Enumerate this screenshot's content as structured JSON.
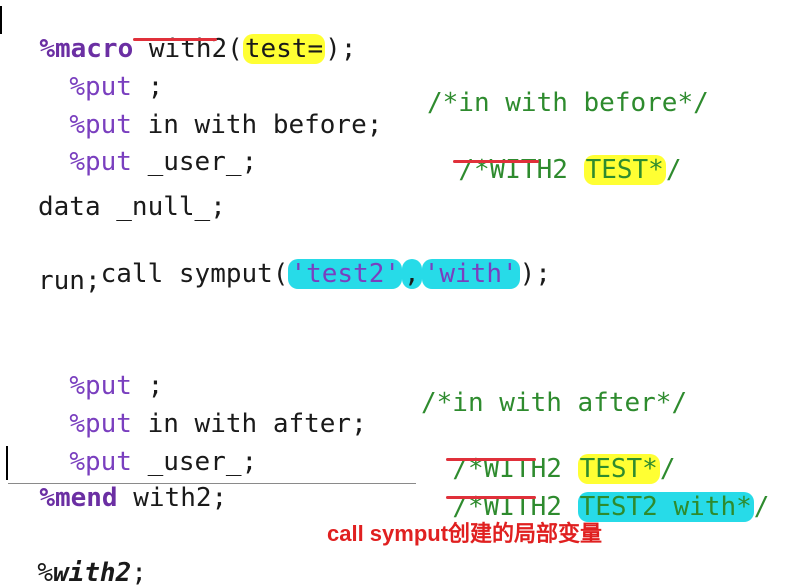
{
  "code": {
    "macro_kw": "%macro",
    "macro_name": "with2",
    "macro_params_open": "(",
    "macro_param": "test=",
    "macro_params_close": ");",
    "l2_put": "%put",
    "l2_rest": " ;",
    "l3_put": "%put",
    "l3_rest": " in with before;",
    "l4_put": "%put",
    "l4_rest": " _user_;",
    "l6": "data _null_;",
    "l7_pre": "  call symput(",
    "l7_arg1": "'test2'",
    "l7_comma": ",",
    "l7_arg2": "'with'",
    "l7_post": ");",
    "l8": "run;",
    "l10_put": "%put",
    "l10_rest": " ;",
    "l11_put": "%put",
    "l11_rest": " in with after;",
    "l12_put": "%put",
    "l12_rest": " _user_;",
    "mend_kw": "%mend",
    "mend_rest": " with2;",
    "invoke_pct": "%",
    "invoke_name": "with2",
    "invoke_semi": ";"
  },
  "comments": {
    "before": "/*in with before*/",
    "before_user_pre": "/*",
    "before_user_name": "WITH2",
    "before_user_sp": " ",
    "before_user_val": "TEST*",
    "before_user_post": "/",
    "after": "/*in with after*/",
    "after_user1_pre": "/*",
    "after_user1_name": "WITH2",
    "after_user1_sp": " ",
    "after_user1_val": "TEST*",
    "after_user1_post": "/",
    "after_user2_pre": "/*",
    "after_user2_name": "WITH2",
    "after_user2_sp": " ",
    "after_user2_val": "TEST2 with*",
    "after_user2_post": "/"
  },
  "caption": "call symput创建的局部变量",
  "colors": {
    "highlight_yellow": "#ffff33",
    "highlight_cyan": "#27dbe8",
    "underline_red": "#e0303a",
    "comment_green": "#2e8b2e",
    "macro_purple": "#7a3fbf",
    "caption_red": "#e02020"
  }
}
